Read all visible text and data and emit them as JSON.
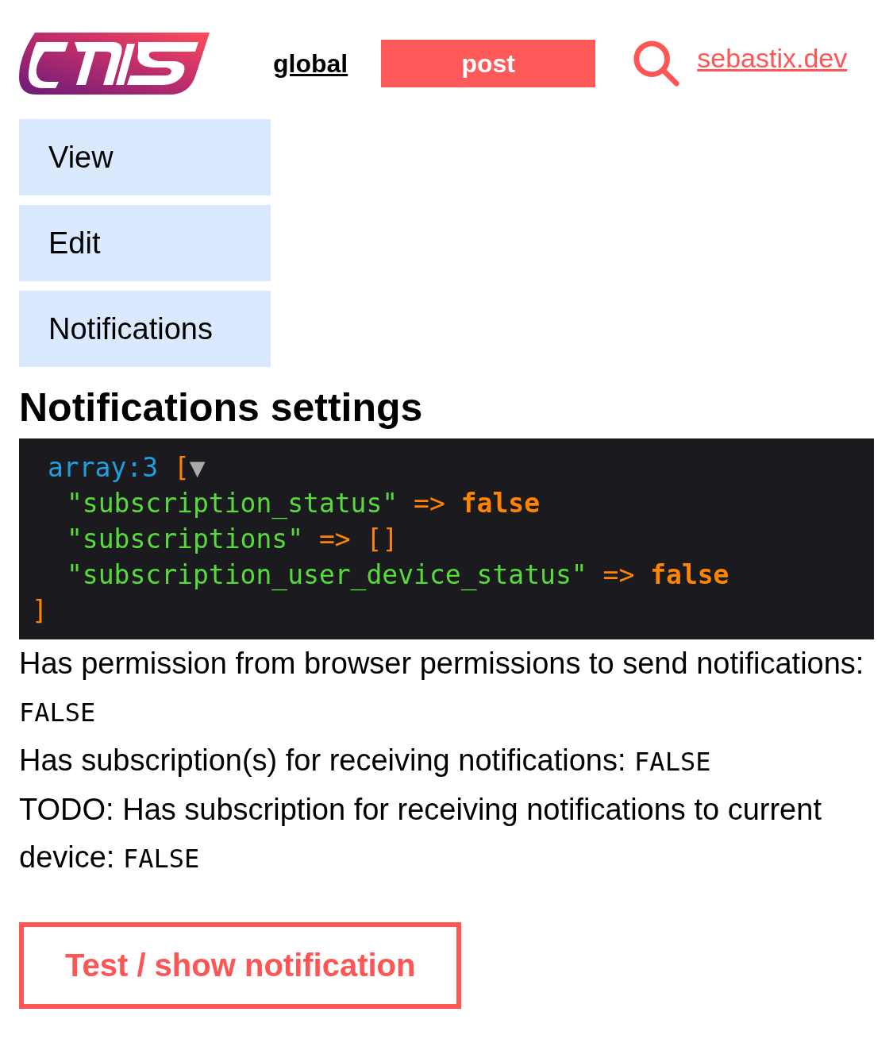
{
  "header": {
    "links": [
      {
        "label": "global",
        "kind": "link"
      },
      {
        "label": "post",
        "kind": "button"
      }
    ],
    "site_link": "sebastix.dev"
  },
  "tabs": [
    "View",
    "Edit",
    "Notifications"
  ],
  "heading": "Notifications settings",
  "dump": {
    "type_label": "array:3",
    "open": "[",
    "toggle": "▼",
    "close": "]",
    "entries": [
      {
        "key": "\"subscription_status\"",
        "arrow": "=>",
        "value": "false",
        "kind": "bool"
      },
      {
        "key": "\"subscriptions\"",
        "arrow": "=>",
        "value": "[]",
        "kind": "array"
      },
      {
        "key": "\"subscription_user_device_status\"",
        "arrow": "=>",
        "value": "false",
        "kind": "bool"
      }
    ]
  },
  "statuses": [
    {
      "text": "Has permission from browser permissions to send notifications:",
      "value": "FALSE"
    },
    {
      "text": "Has subscription(s) for receiving notifications:",
      "value": "FALSE"
    },
    {
      "text": "TODO: Has subscription for receiving notifications to current device:",
      "value": "FALSE"
    }
  ],
  "action_button": "Test / show notification"
}
